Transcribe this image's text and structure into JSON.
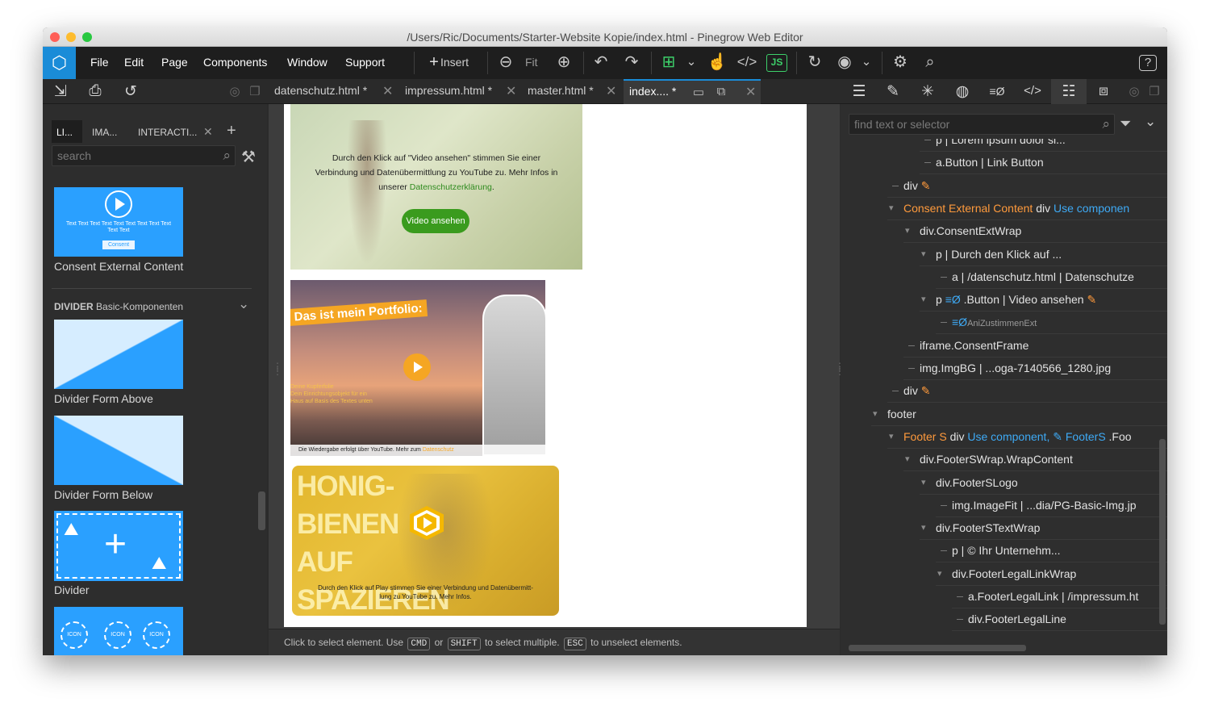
{
  "window": {
    "title": "/Users/Ric/Documents/Starter-Website Kopie/index.html - Pinegrow Web Editor",
    "controls": {
      "close_color": "#ff5f57",
      "minimize_color": "#febc2e",
      "zoom_color": "#28c840"
    }
  },
  "menubar": {
    "items": [
      "File",
      "Edit",
      "Page",
      "Components",
      "Window",
      "Support"
    ],
    "insert_label": "Insert",
    "fit_label": "Fit",
    "js_label": "JS",
    "accent": "#1a8cd8"
  },
  "file_tabs": [
    {
      "label": "datenschutz.html *",
      "close": "✕"
    },
    {
      "label": "impressum.html *",
      "close": "✕"
    },
    {
      "label": "master.html *",
      "close": "✕"
    },
    {
      "label": "index.... *",
      "close": "✕",
      "active": true
    }
  ],
  "left_panel": {
    "tabs": [
      "LI...",
      "IMA...",
      "INTERACTI..."
    ],
    "close_tab": "✕",
    "add_tab": "+",
    "search_placeholder": "search",
    "consent_card": {
      "text": "Text Text Text Text Text Text Text Text Text Text Text",
      "button": "Consent",
      "label": "Consent External Content"
    },
    "divider_section": {
      "name": "DIVIDER",
      "subtitle": "Basic-Komponenten"
    },
    "items": [
      {
        "label": "Divider Form Above"
      },
      {
        "label": "Divider Form Below"
      },
      {
        "label": "Divider"
      }
    ],
    "icon_card_labels": [
      "ICON",
      "ICON",
      "ICON"
    ]
  },
  "canvas": {
    "block1": {
      "text_line1": "Durch den Klick auf \"Video ansehen\" stimmen Sie einer",
      "text_line2": "Verbindung und Datenübermittlung zu YouTube zu. Mehr Infos in",
      "text_line3_prefix": "unserer",
      "text_link": "Datenschutzerklärung",
      "text_line3_suffix": ".",
      "button": "Video ansehen",
      "button_color": "#3a9b1e"
    },
    "block2": {
      "headline": "Das ist mein Portfolio:",
      "overlay_lines": [
        "Deine Kupferfolie",
        "Dein Einrichtungsobjekt für ein",
        "Haus auf Basis des Textes unten"
      ],
      "caption_prefix": "Die Wiedergabe erfolgt über YouTube. Mehr zum",
      "caption_link": "Datenschutz",
      "play_color": "#f5a623"
    },
    "block3": {
      "headline_lines": [
        "HONIG-",
        "BIENEN",
        "AUF",
        "SPAZIEREN"
      ],
      "caption_line1": "Durch den Klick auf Play stimmen Sie einer Verbindung und Datenübermitt-",
      "caption_line2": "lung zu YouTube zu. Mehr Infos.",
      "play_color": "#f5b800"
    }
  },
  "status_bar": {
    "text1": "Click to select element. Use",
    "key1": "CMD",
    "text2": "or",
    "key2": "SHIFT",
    "text3": "to select multiple.",
    "key3": "ESC",
    "text4": "to unselect elements."
  },
  "right_panel": {
    "search_placeholder": "find text or selector",
    "tree": [
      {
        "depth": 4,
        "toggle": "",
        "text": "p | Lorem ipsum dolor si..."
      },
      {
        "depth": 4,
        "toggle": "",
        "text": "a.Button | Link Button"
      },
      {
        "depth": 2,
        "toggle": "",
        "text": "div",
        "brush": true
      },
      {
        "depth": 2,
        "toggle": "▾",
        "name": "Consent External Content",
        "text": " div ",
        "link": "Use componen"
      },
      {
        "depth": 3,
        "toggle": "▾",
        "text": "div.ConsentExtWrap"
      },
      {
        "depth": 4,
        "toggle": "▾",
        "text": "p | Durch den Klick auf ..."
      },
      {
        "depth": 5,
        "toggle": "",
        "text": "a | /datenschutz.html | Datenschutze"
      },
      {
        "depth": 4,
        "toggle": "▾",
        "text": "p ",
        "interact": "≡Ø",
        "text2": " .Button | Video ansehen",
        "brush": true
      },
      {
        "depth": 5,
        "toggle": "",
        "small": "AniZustimmenExt",
        "interact": "≡Ø"
      },
      {
        "depth": 3,
        "toggle": "",
        "text": "iframe.ConsentFrame"
      },
      {
        "depth": 3,
        "toggle": "",
        "text": "img.ImgBG | ...oga-7140566_1280.jpg"
      },
      {
        "depth": 2,
        "toggle": "",
        "text": "div",
        "brush": true
      },
      {
        "depth": 1,
        "toggle": "▾",
        "text": "footer"
      },
      {
        "depth": 2,
        "toggle": "▾",
        "name": "Footer S",
        "text": " div ",
        "link": "Use component,",
        "link2": " ✎ FooterS",
        "text2": " .Foo"
      },
      {
        "depth": 3,
        "toggle": "▾",
        "text": "div.FooterSWrap.WrapContent"
      },
      {
        "depth": 4,
        "toggle": "▾",
        "text": "div.FooterSLogo"
      },
      {
        "depth": 5,
        "toggle": "",
        "text": "img.ImageFit | ...dia/PG-Basic-Img.jp"
      },
      {
        "depth": 4,
        "toggle": "▾",
        "text": "div.FooterSTextWrap"
      },
      {
        "depth": 5,
        "toggle": "",
        "text": "p | © Ihr Unternehm..."
      },
      {
        "depth": 5,
        "toggle": "▾",
        "text": "div.FooterLegalLinkWrap"
      },
      {
        "depth": 6,
        "toggle": "",
        "text": "a.FooterLegalLink | /impressum.ht"
      },
      {
        "depth": 6,
        "toggle": "",
        "text": "div.FooterLegalLine"
      }
    ]
  }
}
